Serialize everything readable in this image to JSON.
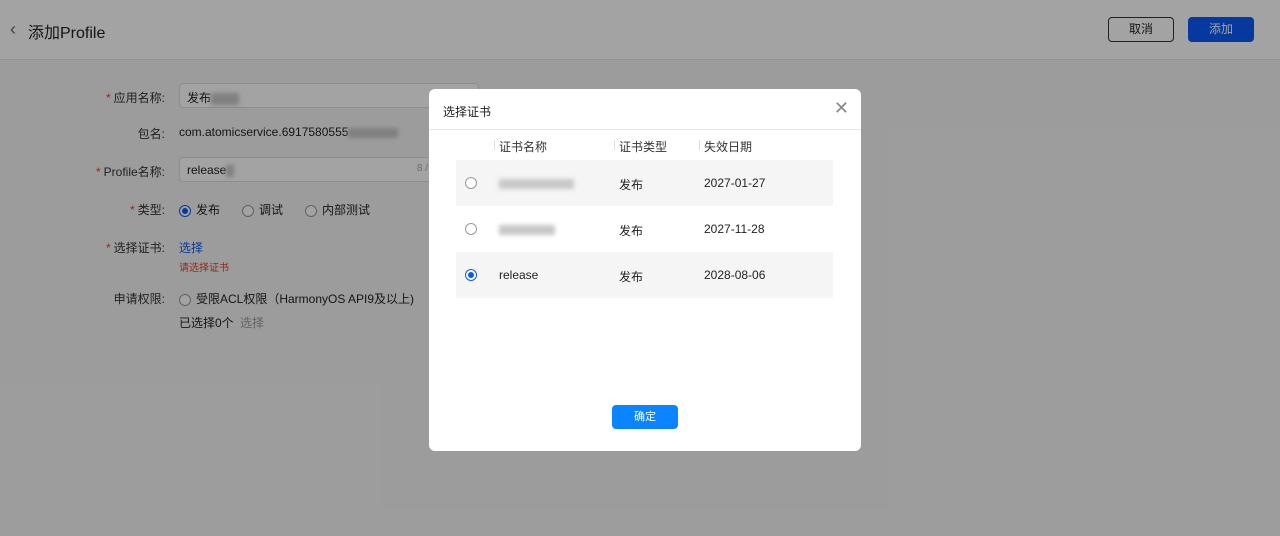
{
  "header": {
    "title": "添加Profile",
    "cancel": "取消",
    "add": "添加"
  },
  "form": {
    "app_name_label": "应用名称:",
    "app_name_value": "发布",
    "package_label": "包名:",
    "package_value": "com.atomicservice.6917580555",
    "profile_label": "Profile名称:",
    "profile_value": "release",
    "profile_count": "8 /",
    "type_label": "类型:",
    "type_options": [
      "发布",
      "调试",
      "内部测试"
    ],
    "type_selected": "发布",
    "cert_label": "选择证书:",
    "cert_link": "选择",
    "cert_error": "请选择证书",
    "perm_label": "申请权限:",
    "perm_option": "受限ACL权限（HarmonyOS API9及以上)",
    "perm_selected": "已选择0个",
    "perm_link": "选择"
  },
  "modal": {
    "title": "选择证书",
    "confirm": "确定",
    "columns": [
      "证书名称",
      "证书类型",
      "失效日期"
    ],
    "rows": [
      {
        "name": "",
        "type": "发布",
        "date": "2027-01-27",
        "selected": false
      },
      {
        "name": "",
        "type": "发布",
        "date": "2027-11-28",
        "selected": false
      },
      {
        "name": "release",
        "type": "发布",
        "date": "2028-08-06",
        "selected": true
      }
    ]
  },
  "colors": {
    "accent": "#0a59f7",
    "error": "#e84026"
  }
}
